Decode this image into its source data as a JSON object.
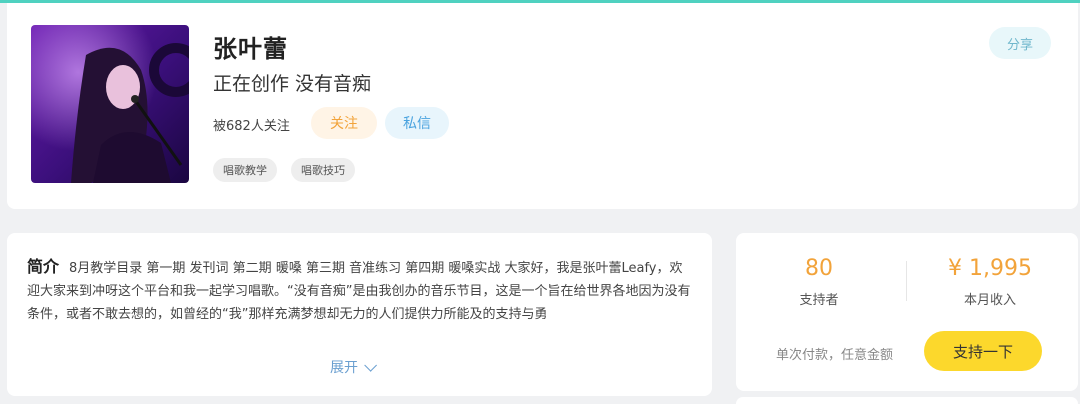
{
  "profile": {
    "name": "张叶蕾",
    "subtitle": "正在创作 没有音痴",
    "followers_text": "被682人关注",
    "follow_label": "关注",
    "message_label": "私信",
    "share_label": "分享",
    "tags": [
      "唱歌教学",
      "唱歌技巧"
    ]
  },
  "intro": {
    "heading": "简介",
    "text": "8月教学目录 第一期 发刊词 第二期 暖嗓 第三期 音准练习 第四期 暖嗓实战 大家好，我是张叶蕾Leafy，欢迎大家来到冲呀这个平台和我一起学习唱歌。“没有音痴”是由我创办的音乐节目，这是一个旨在给世界各地因为没有条件，或者不敢去想的，如曾经的“我”那样充满梦想却无力的人们提供力所能及的支持与勇",
    "expand_label": "展开"
  },
  "support": {
    "supporters_value": "80",
    "supporters_label": "支持者",
    "income_value": "¥ 1,995",
    "income_label": "本月收入",
    "pay_note": "单次付款，任意金额",
    "support_label": "支持一下"
  },
  "colors": {
    "accent_teal": "#4fd1c0",
    "orange": "#f2a33a",
    "blue": "#4aa3df",
    "yellow": "#fcd82c"
  }
}
